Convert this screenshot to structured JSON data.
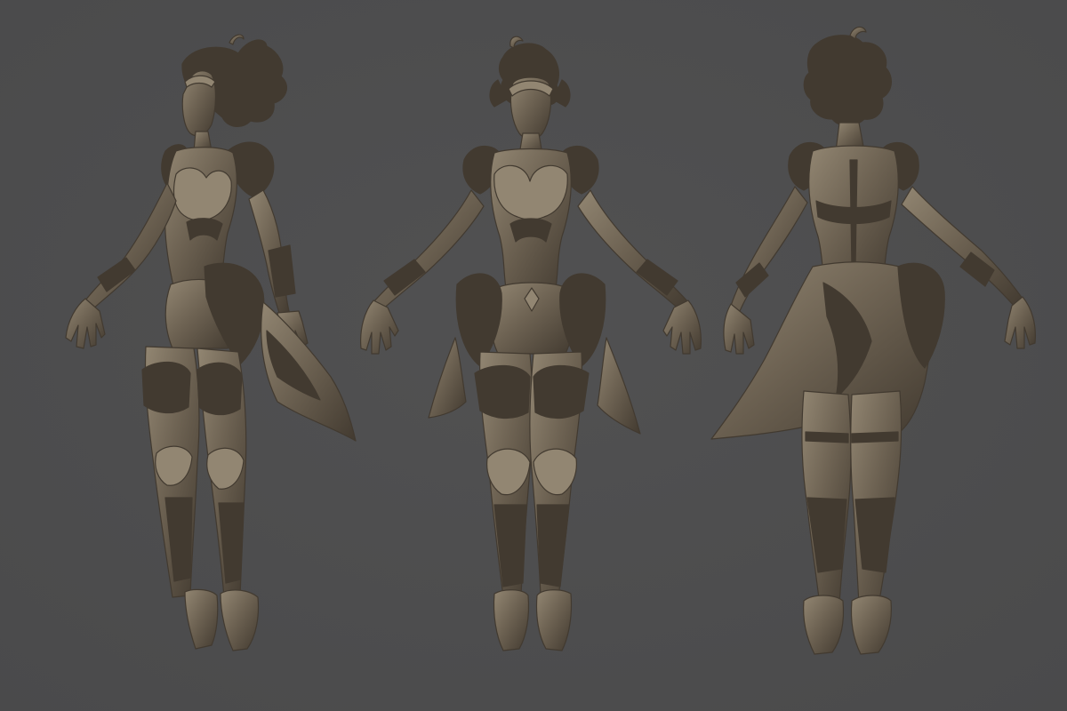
{
  "scene": {
    "background_color": "#4a4a4b",
    "clay_color": "#6e6353",
    "clay_shadow_color": "#423a30",
    "clay_highlight_color": "#928672",
    "views": [
      {
        "view": "three-quarter"
      },
      {
        "view": "front"
      },
      {
        "view": "back"
      }
    ]
  }
}
